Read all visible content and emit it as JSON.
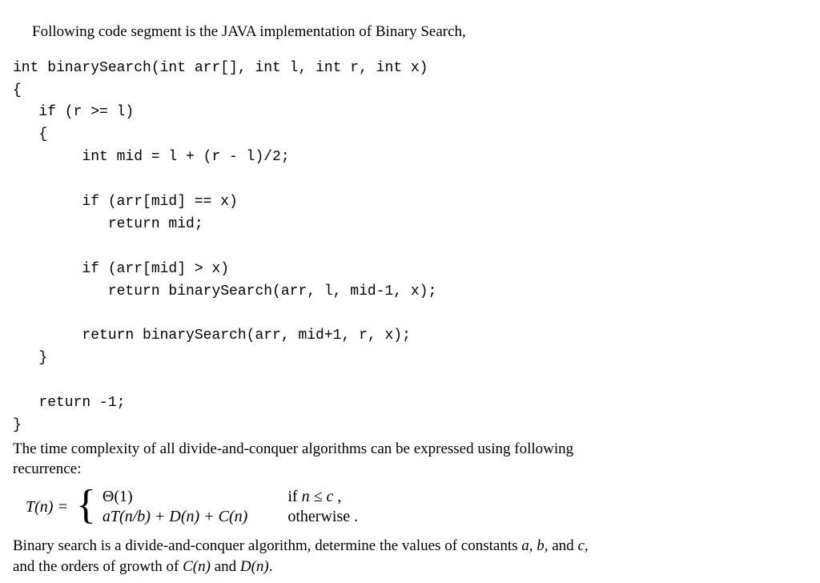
{
  "intro": "Following code segment is the JAVA implementation of Binary Search,",
  "code": "int binarySearch(int arr[], int l, int r, int x)\n{\n   if (r >= l)\n   {\n        int mid = l + (r - l)/2;\n\n        if (arr[mid] == x)\n           return mid;\n\n        if (arr[mid] > x)\n           return binarySearch(arr, l, mid-1, x);\n\n        return binarySearch(arr, mid+1, r, x);\n   }\n\n   return -1;\n}",
  "para2a": "The time complexity of all divide-and-conquer algorithms can be expressed using following",
  "para2b": "recurrence:",
  "tn_label": "T(n) = ",
  "case1_expr": "Θ(1)",
  "case1_cond_prefix": "if ",
  "case1_cond_var": "n ≤ c",
  "case1_cond_suffix": " ,",
  "case2_expr_a": "aT",
  "case2_expr_b": "(n/b) + D(n) + C(n)",
  "case2_cond": "otherwise .",
  "para3a": "Binary search is a divide-and-conquer algorithm, determine the values of constants ",
  "para3_vars": "a, b,",
  "para3_mid": " and ",
  "para3_c": "c",
  "para3_comma": ",",
  "para3b_pre": "and the orders of growth of ",
  "para3b_cn": "C(n)",
  "para3b_and": " and ",
  "para3b_dn": "D(n)",
  "para3b_end": "."
}
